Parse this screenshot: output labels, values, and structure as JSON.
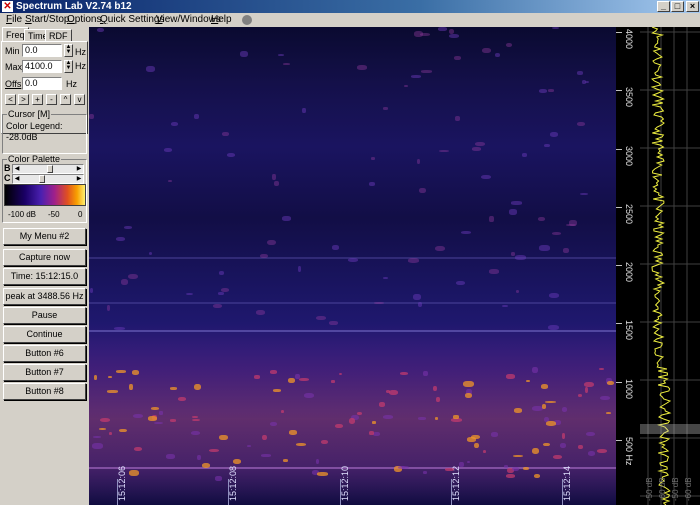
{
  "window": {
    "title": "Spectrum Lab V2.74 b12",
    "minimize": "_",
    "maximize": "□",
    "close": "×"
  },
  "menu": [
    "File",
    "Start/Stop",
    "Options",
    "Quick Settings",
    "View/Windows",
    "Help"
  ],
  "tabs": [
    "Freq",
    "Time",
    "RDF"
  ],
  "freq": {
    "min_label": "Min",
    "min_value": "0.0",
    "min_unit": "Hz",
    "max_label": "Max",
    "max_value": "4100.0",
    "max_unit": "Hz",
    "offs_label": "Offs",
    "offs_value": "0.0",
    "offs_unit": "Hz",
    "nav": [
      "<",
      ">",
      "+",
      "-",
      "^",
      "v"
    ]
  },
  "cursor": {
    "title": "Cursor  [M]",
    "legend_label": "Color Legend:",
    "legend_value": "-28.0dB"
  },
  "palette": {
    "title": "Color Palette",
    "b_label": "B",
    "c_label": "C",
    "scale": [
      "-100 dB",
      "-50",
      "0"
    ]
  },
  "buttons": [
    "My Menu #2",
    "Capture now",
    "Time:  15:12:15.0",
    "peak at 3488.56 Hz",
    "Pause",
    "Continue",
    "Button #6",
    "Button #7",
    "Button #8"
  ],
  "spectrogram": {
    "time_labels": [
      "15:12:06",
      "15:12:08",
      "15:12:10",
      "15:12:12",
      "15:12:14"
    ],
    "freq_labels": [
      "4000",
      "3500",
      "3000",
      "2500",
      "2000",
      "1500",
      "1000",
      "500 Hz"
    ],
    "scope_labels": [
      "-50 dB",
      "-60 dB",
      "-50 dB",
      "-60 dB"
    ]
  },
  "colors": {
    "titlebar": "#0a246a",
    "panel": "#d4d0c8",
    "scope_trace": "#f0f040",
    "spectro_bg": "#14104a"
  }
}
